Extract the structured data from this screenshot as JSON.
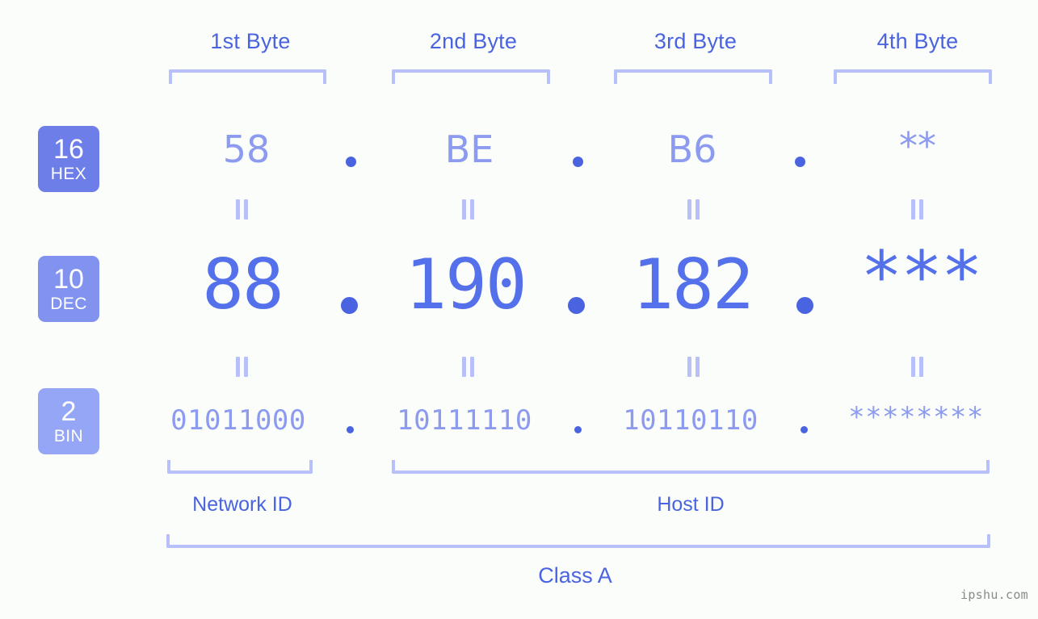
{
  "colors": {
    "background": "#fbfdfa",
    "accent_strong": "#4a63e0",
    "accent_mid": "#5470ea",
    "accent_light": "#8c9bef",
    "bracket": "#b7c0fa",
    "badge_hex": "#6d7ee8",
    "badge_dec": "#8193ef",
    "badge_bin": "#94a6f5",
    "watermark": "#8a8a8a"
  },
  "headers": [
    {
      "label": "1st Byte"
    },
    {
      "label": "2nd Byte"
    },
    {
      "label": "3rd Byte"
    },
    {
      "label": "4th Byte"
    }
  ],
  "bases": [
    {
      "number": "16",
      "abbr": "HEX"
    },
    {
      "number": "10",
      "abbr": "DEC"
    },
    {
      "number": "2",
      "abbr": "BIN"
    }
  ],
  "rows": {
    "hex": {
      "base": "16",
      "abbr": "HEX",
      "values": [
        "58",
        "BE",
        "B6",
        "**"
      ]
    },
    "dec": {
      "base": "10",
      "abbr": "DEC",
      "values": [
        "88",
        "190",
        "182",
        "***"
      ]
    },
    "bin": {
      "base": "2",
      "abbr": "BIN",
      "values": [
        "01011000",
        "10111110",
        "10110110",
        "********"
      ]
    }
  },
  "separator": ".",
  "equality_symbol": "=",
  "segments": {
    "network_id": "Network ID",
    "host_id": "Host ID"
  },
  "class": {
    "label": "Class A"
  },
  "watermark": "ipshu.com"
}
